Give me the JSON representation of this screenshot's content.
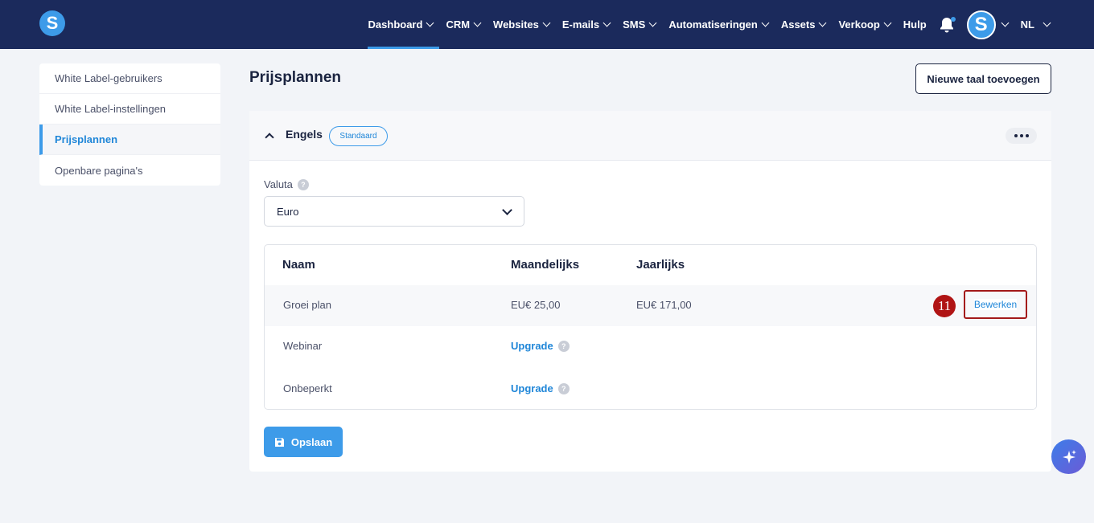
{
  "app": {
    "logo_letter": "S"
  },
  "nav": {
    "items": [
      {
        "label": "Dashboard",
        "dropdown": true,
        "active": true
      },
      {
        "label": "CRM",
        "dropdown": true
      },
      {
        "label": "Websites",
        "dropdown": true
      },
      {
        "label": "E-mails",
        "dropdown": true
      },
      {
        "label": "SMS",
        "dropdown": true
      },
      {
        "label": "Automatiseringen",
        "dropdown": true
      },
      {
        "label": "Assets",
        "dropdown": true
      },
      {
        "label": "Verkoop",
        "dropdown": true
      },
      {
        "label": "Hulp",
        "dropdown": false
      }
    ],
    "avatar_letter": "S",
    "language": "NL"
  },
  "sidebar": {
    "items": [
      {
        "label": "White Label-gebruikers"
      },
      {
        "label": "White Label-instellingen"
      },
      {
        "label": "Prijsplannen",
        "active": true
      },
      {
        "label": "Openbare pagina's"
      }
    ]
  },
  "main": {
    "title": "Prijsplannen",
    "new_language_label": "Nieuwe taal toevoegen",
    "language_section": {
      "name": "Engels",
      "badge": "Standaard",
      "currency_label": "Valuta",
      "currency_value": "Euro",
      "table": {
        "headers": [
          "Naam",
          "Maandelijks",
          "Jaarlijks"
        ],
        "rows": [
          {
            "name": "Groei plan",
            "monthly": "EU€ 25,00",
            "yearly": "EU€ 171,00",
            "action": "Bewerken"
          },
          {
            "name": "Webinar",
            "monthly": "Upgrade"
          },
          {
            "name": "Onbeperkt",
            "monthly": "Upgrade"
          }
        ]
      },
      "save_label": "Opslaan"
    },
    "step_marker": "11"
  },
  "colors": {
    "navbar": "#1b2a5c",
    "accent": "#3d9be9",
    "highlight": "#a31919"
  }
}
